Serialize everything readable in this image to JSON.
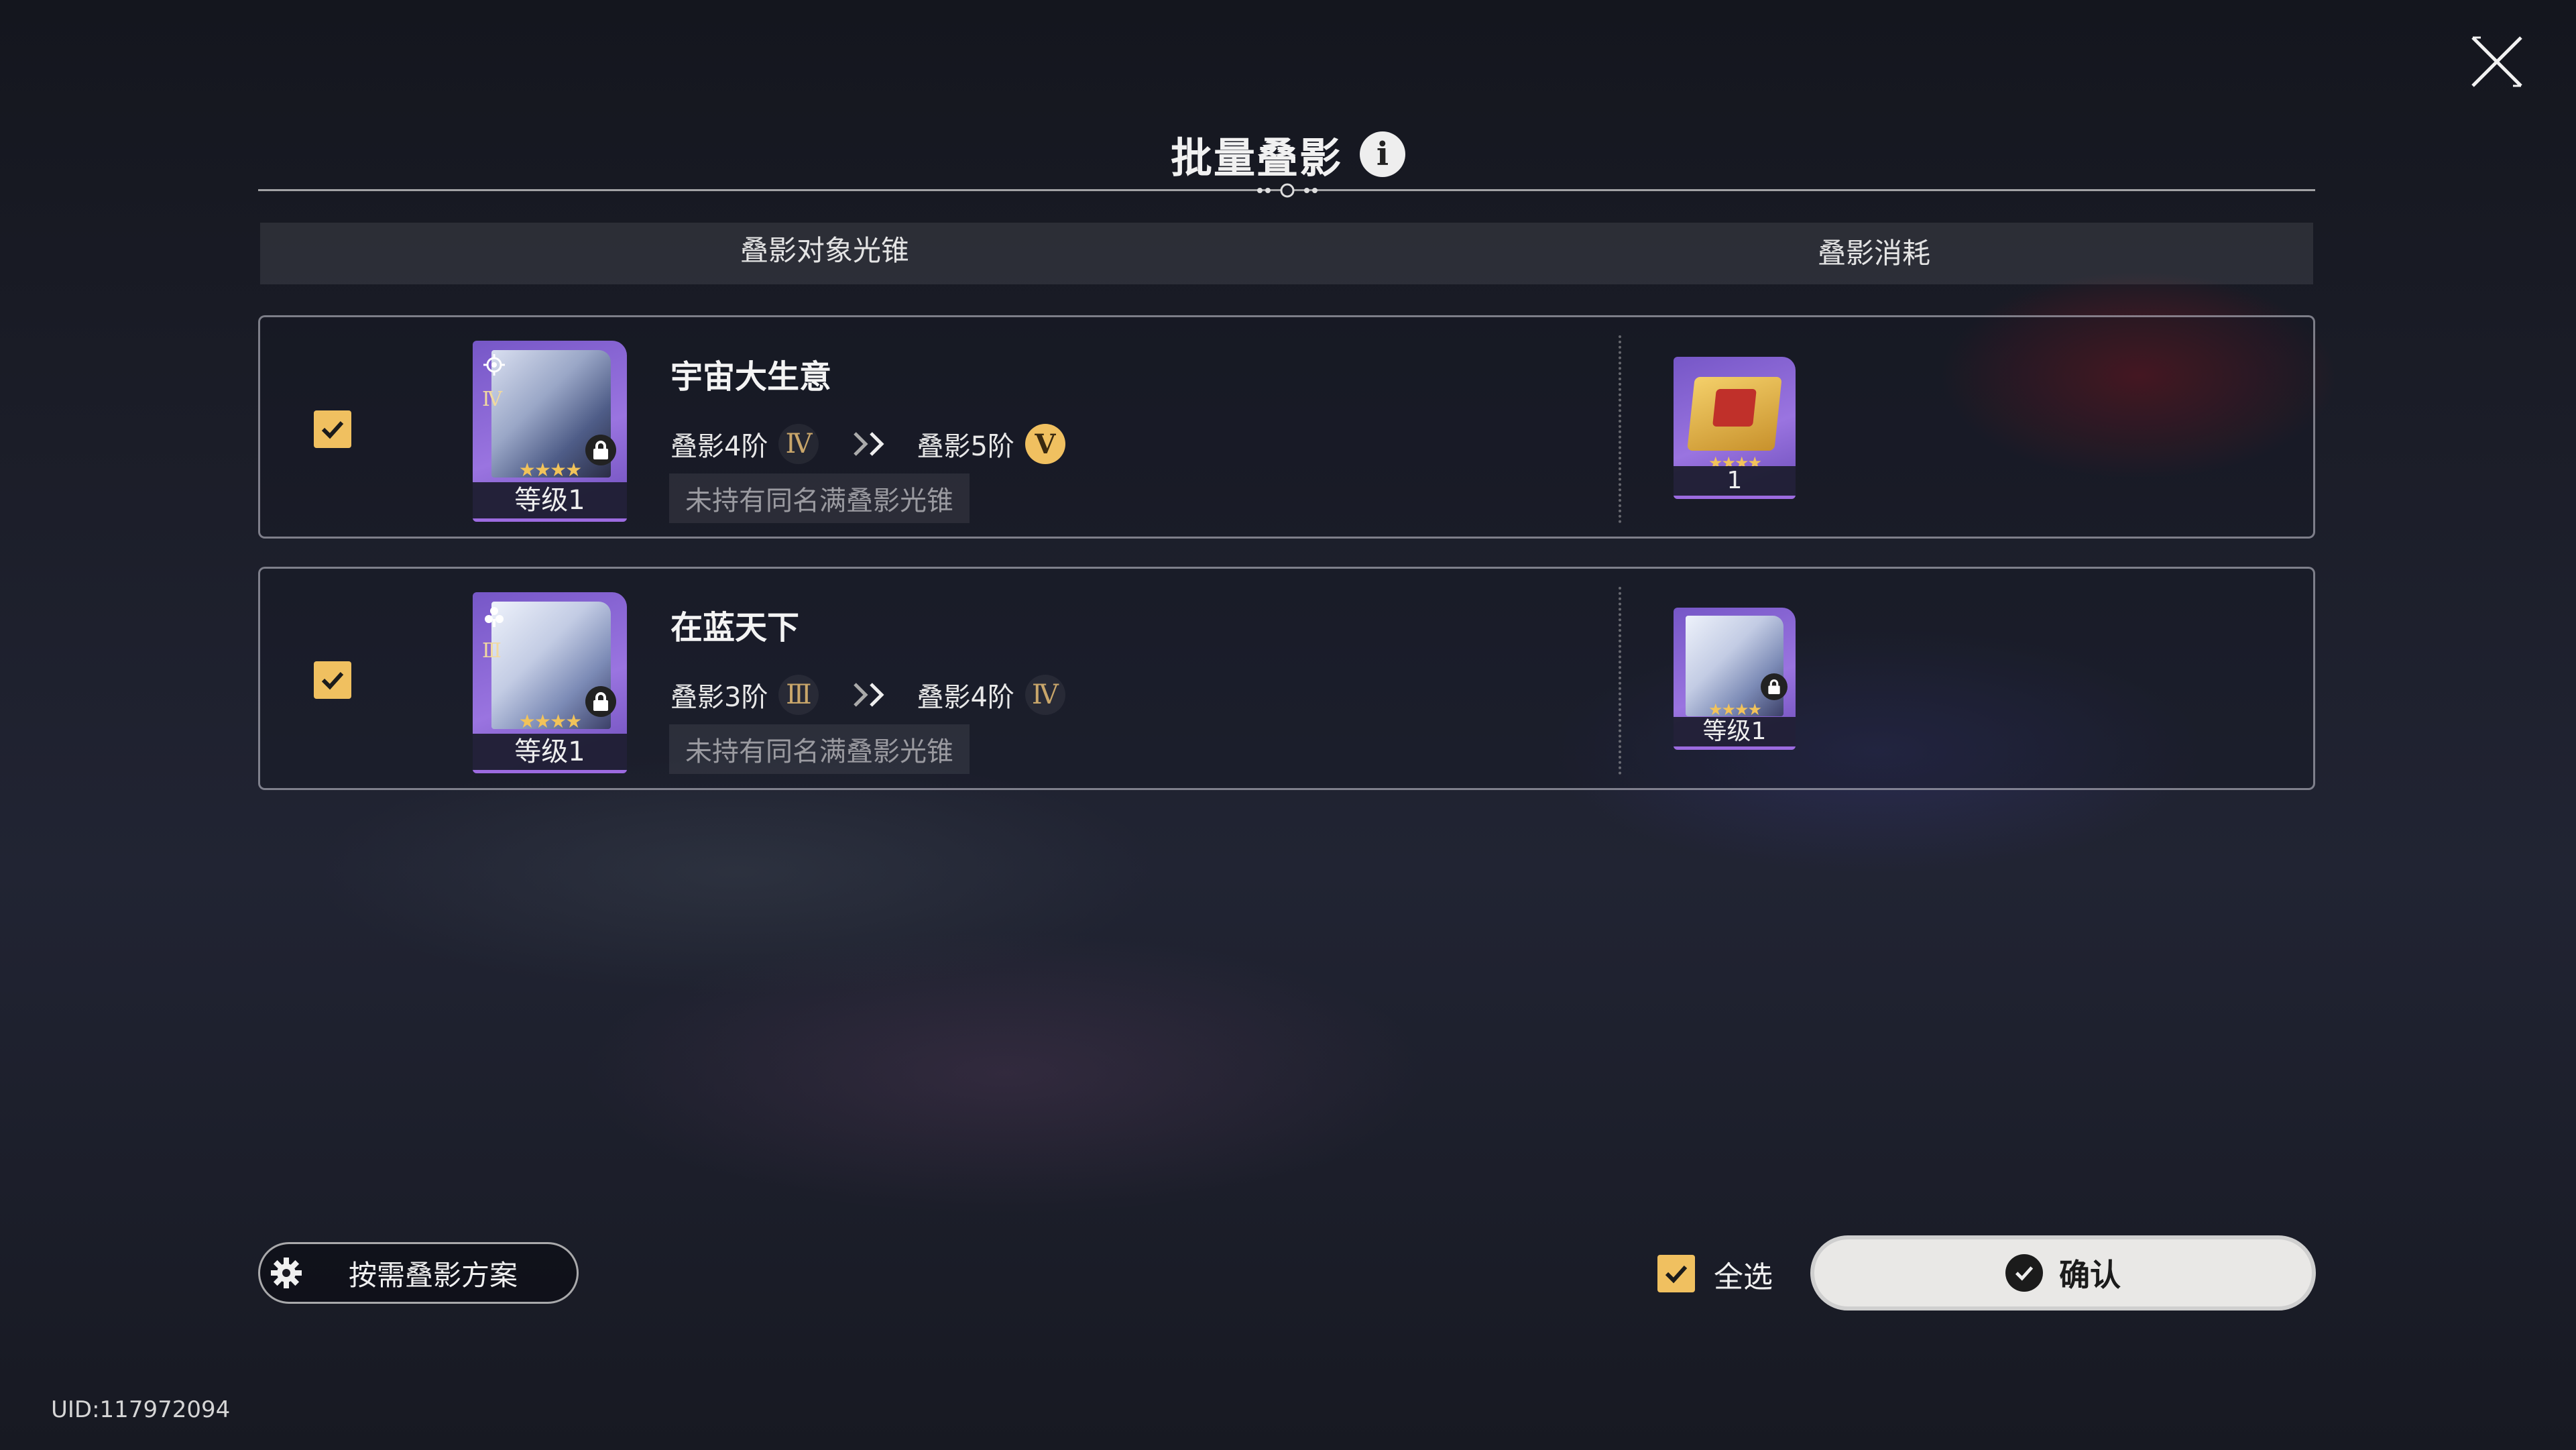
{
  "header": {
    "title": "批量叠影",
    "info_icon": "info-icon",
    "close_icon": "close-icon"
  },
  "columns": {
    "target": "叠影对象光锥",
    "cost": "叠影消耗"
  },
  "rows": [
    {
      "checked": true,
      "name": "宇宙大生意",
      "card_level": "等级1",
      "card_rank": "Ⅳ",
      "from_label": "叠影4阶",
      "from_roman": "Ⅳ",
      "to_label": "叠影5阶",
      "to_roman": "Ⅴ",
      "note": "未持有同名满叠影光锥",
      "cost_label": "1",
      "cost_item": "superimposition-book"
    },
    {
      "checked": true,
      "name": "在蓝天下",
      "card_level": "等级1",
      "card_rank": "Ⅲ",
      "from_label": "叠影3阶",
      "from_roman": "Ⅲ",
      "to_label": "叠影4阶",
      "to_roman": "Ⅳ",
      "note": "未持有同名满叠影光锥",
      "cost_label": "等级1",
      "cost_item": "light-cone-card"
    }
  ],
  "footer": {
    "plan_button": "按需叠影方案",
    "select_all": "全选",
    "select_all_checked": true,
    "confirm": "确认",
    "uid": "UID:117972094"
  },
  "colors": {
    "accent_gold": "#f0c060",
    "card_purple": "#8a65d6",
    "confirm_bg": "#e9e8e6"
  }
}
